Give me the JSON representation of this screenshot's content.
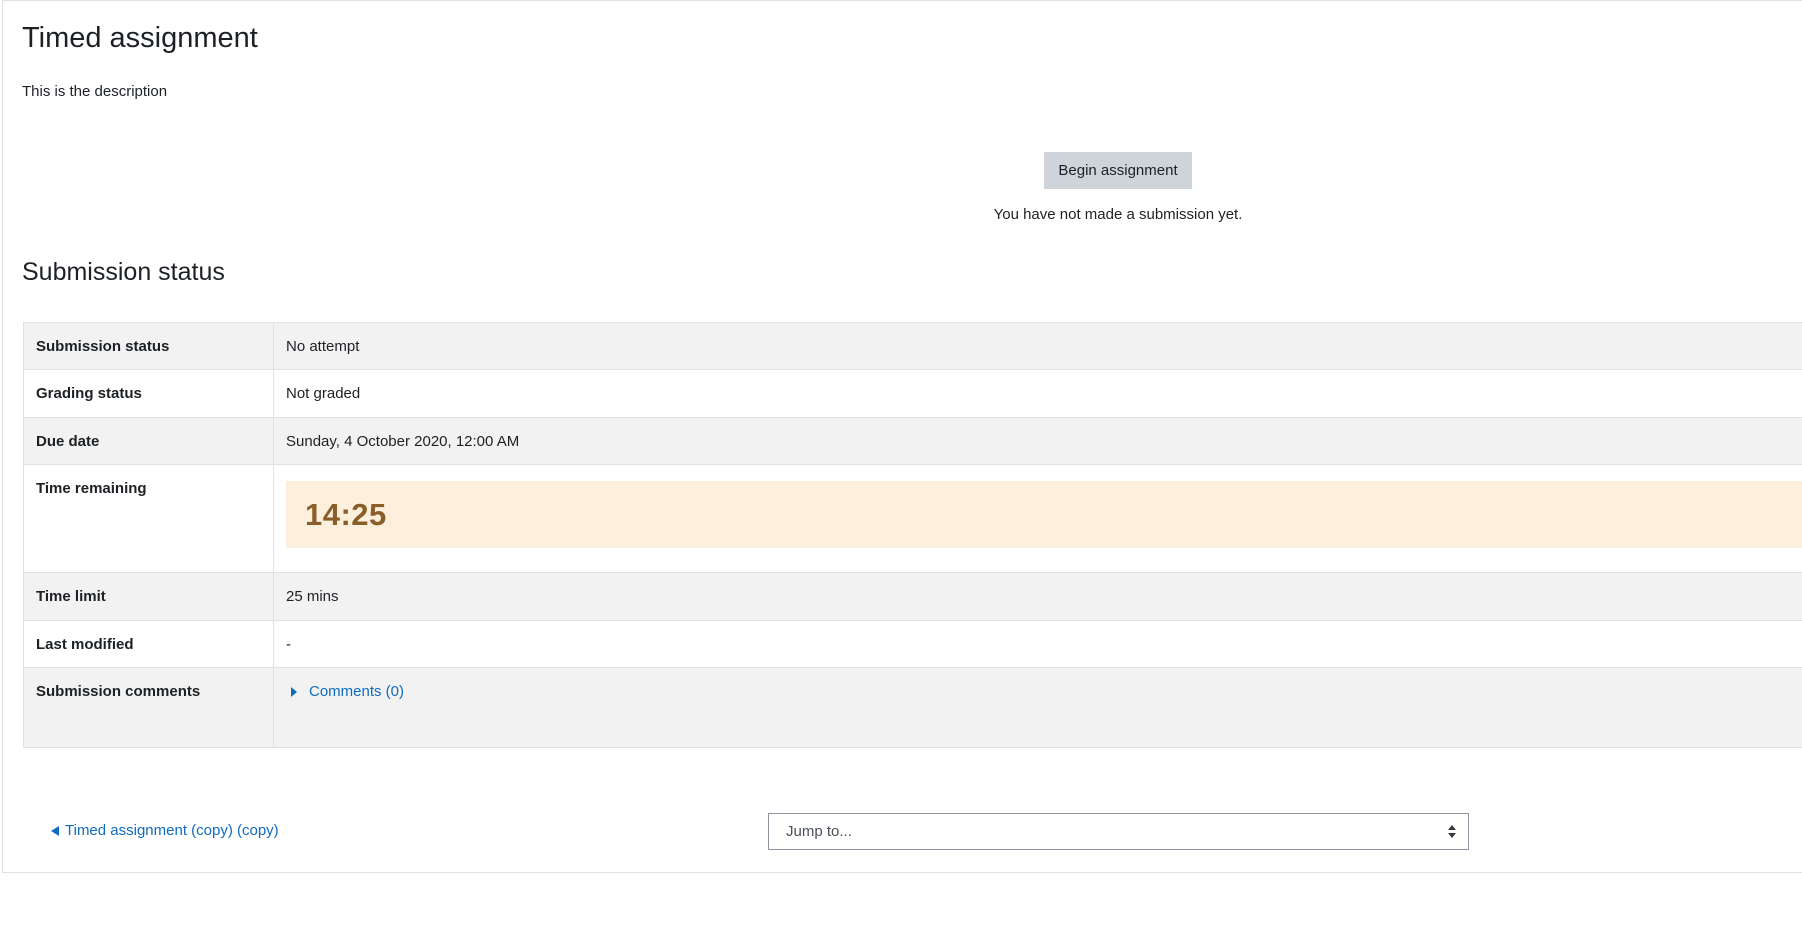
{
  "page": {
    "title": "Timed assignment",
    "description": "This is the description"
  },
  "intro": {
    "begin_button_label": "Begin assignment",
    "no_submission_text": "You have not made a submission yet."
  },
  "submission_status": {
    "heading": "Submission status",
    "rows": [
      {
        "label": "Submission status",
        "value": "No attempt"
      },
      {
        "label": "Grading status",
        "value": "Not graded"
      },
      {
        "label": "Due date",
        "value": "Sunday, 4 October 2020, 12:00 AM"
      },
      {
        "label": "Time remaining",
        "value": "14:25"
      },
      {
        "label": "Time limit",
        "value": "25 mins"
      },
      {
        "label": "Last modified",
        "value": "-"
      },
      {
        "label": "Submission comments",
        "value": "Comments (0)"
      }
    ]
  },
  "navigation": {
    "previous_activity_label": "Timed assignment (copy) (copy)",
    "jump_to_placeholder": "Jump to..."
  },
  "colors": {
    "link": "#0f6cbf",
    "timer_background": "#fcefdc",
    "timer_text": "#8a5e29",
    "button_background": "#ced4da",
    "row_shade": "#f2f2f2"
  },
  "icons": {
    "comments_toggle": "caret-right-icon",
    "previous": "arrow-left-icon",
    "select": "select-arrows-icon"
  }
}
